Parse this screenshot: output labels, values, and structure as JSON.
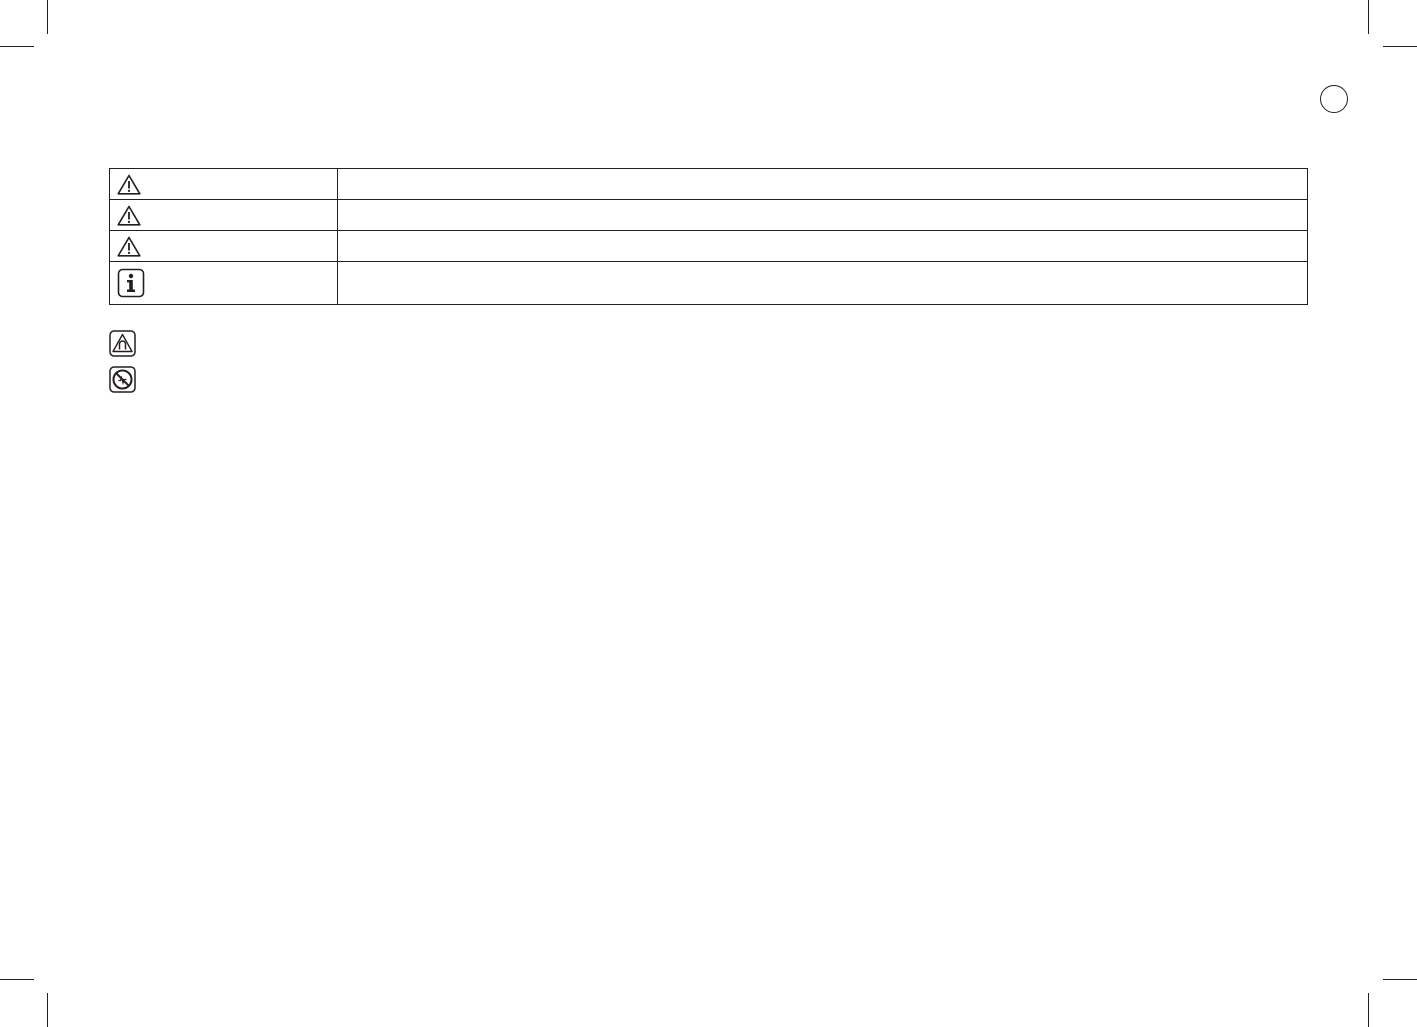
{
  "page": {
    "marker": "circle-outline"
  },
  "symbol_table": {
    "rows": [
      {
        "icon": "warning-triangle-icon",
        "text": ""
      },
      {
        "icon": "warning-triangle-icon",
        "text": ""
      },
      {
        "icon": "warning-triangle-icon",
        "text": ""
      },
      {
        "icon": "info-icon",
        "text": ""
      }
    ]
  },
  "symbols_below": [
    {
      "icon": "magnetic-field-warning-icon"
    },
    {
      "icon": "no-pacemaker-icon"
    }
  ]
}
